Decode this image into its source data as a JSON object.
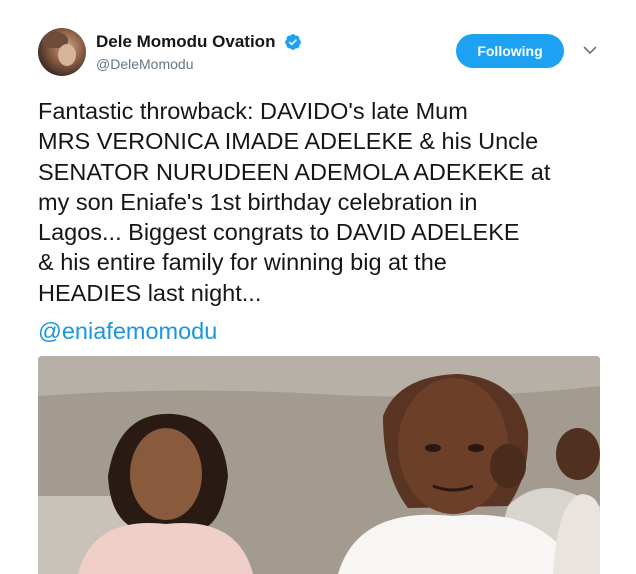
{
  "author": {
    "display_name": "Dele Momodu Ovation",
    "handle": "@DeleMomodu",
    "verified": true
  },
  "follow_button": {
    "label": "Following",
    "color": "#1da1f2"
  },
  "tweet": {
    "lines": [
      "Fantastic throwback: DAVIDO's late Mum",
      "MRS VERONICA IMADE ADELEKE & his Uncle",
      "SENATOR NURUDEEN ADEMOLA ADEKEKE at",
      "my son Eniafe's 1st birthday celebration in",
      "Lagos... Biggest congrats to DAVID ADELEKE",
      "& his entire family for winning big at the",
      "HEADIES last night..."
    ],
    "mention": "@eniafemomodu",
    "mention_color": "#1b95e0"
  },
  "icons": {
    "verified": "verified-badge-icon",
    "menu": "chevron-down-icon"
  }
}
